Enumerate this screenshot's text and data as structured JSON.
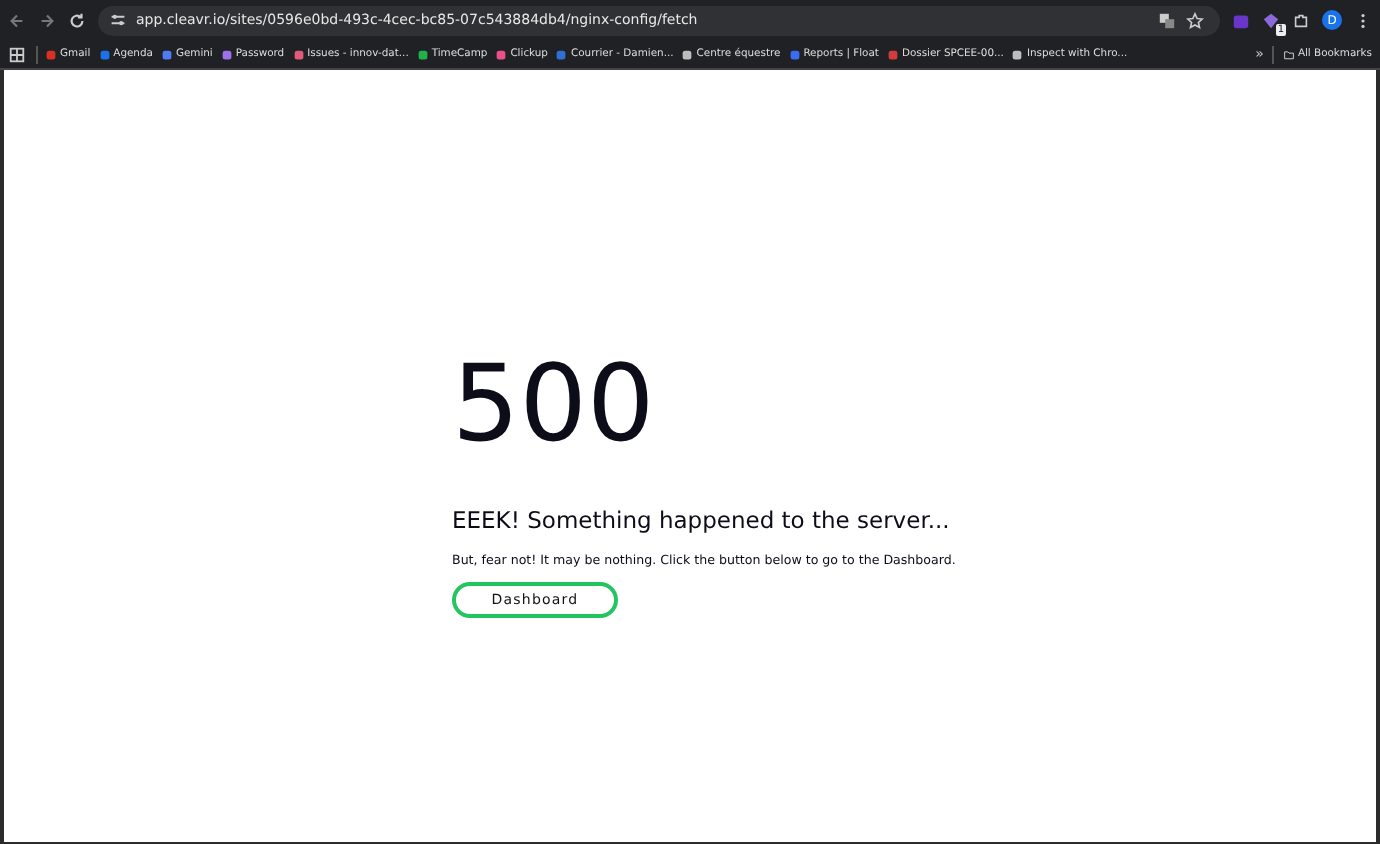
{
  "browser": {
    "url": "app.cleavr.io/sites/0596e0bd-493c-4cec-bc85-07c543884db4/nginx-config/fetch",
    "extension_badge": "1",
    "profile_initial": "D"
  },
  "bookmarks": [
    {
      "label": "Gmail",
      "color": "#d93025"
    },
    {
      "label": "Agenda",
      "color": "#1a73e8"
    },
    {
      "label": "Gemini",
      "color": "#4e7cf2"
    },
    {
      "label": "Password",
      "color": "#9b72e8"
    },
    {
      "label": "Issues - innov-dat...",
      "color": "#e05a7a"
    },
    {
      "label": "TimeCamp",
      "color": "#1fb24a"
    },
    {
      "label": "Clickup",
      "color": "#e94f8a"
    },
    {
      "label": "Courrier - Damien...",
      "color": "#2f6fd6"
    },
    {
      "label": "Centre équestre",
      "color": "#bdbdbd"
    },
    {
      "label": "Reports | Float",
      "color": "#3a6df0"
    },
    {
      "label": "Dossier SPCEE-00...",
      "color": "#d23c3c"
    },
    {
      "label": "Inspect with Chro...",
      "color": "#bdbdbd"
    }
  ],
  "bookmarks_more": "»",
  "all_bookmarks": "All Bookmarks",
  "error": {
    "code": "500",
    "heading": "EEEK! Something happened to the server...",
    "message": "But, fear not! It may be nothing. Click the button below to go to the Dashboard.",
    "button": "Dashboard"
  }
}
